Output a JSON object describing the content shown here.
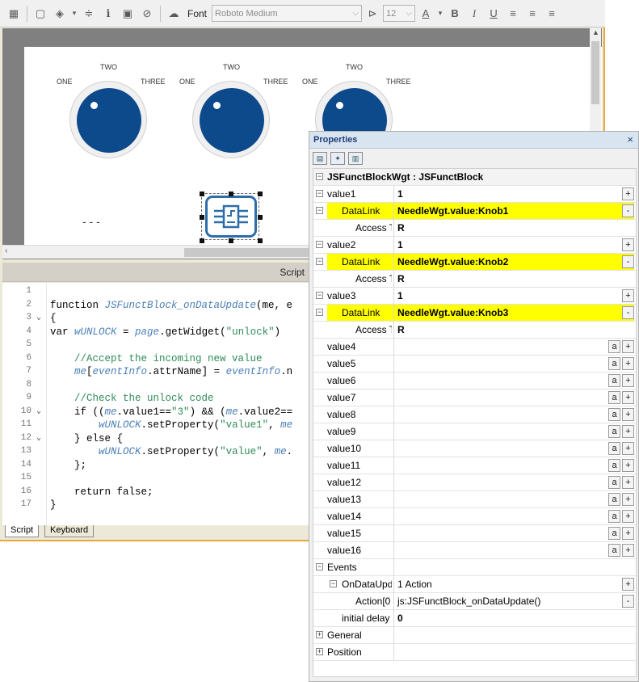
{
  "toolbar": {
    "font_label": "Font",
    "font_value": "Roboto Medium",
    "size_value": "12"
  },
  "knobs": [
    {
      "one": "ONE",
      "two": "TWO",
      "three": "THREE"
    },
    {
      "one": "ONE",
      "two": "TWO",
      "three": "THREE"
    },
    {
      "one": "ONE",
      "two": "TWO",
      "three": "THREE"
    }
  ],
  "canvas": {
    "dashes": "- - -"
  },
  "script": {
    "header": "Script",
    "lines": [
      {
        "n": "1",
        "fold": "",
        "html": ""
      },
      {
        "n": "2",
        "fold": "",
        "html": "function <span class='fn'>JSFunctBlock_onDataUpdate</span>(me, e"
      },
      {
        "n": "3",
        "fold": "⌄",
        "html": "{"
      },
      {
        "n": "4",
        "fold": "",
        "html": "var <span class='var'>wUNLOCK</span> = <span class='var'>page</span>.getWidget(<span class='str'>\"unlock\"</span>)"
      },
      {
        "n": "5",
        "fold": "",
        "html": ""
      },
      {
        "n": "6",
        "fold": "",
        "html": "    <span class='com'>//Accept the incoming new value</span>"
      },
      {
        "n": "7",
        "fold": "",
        "html": "    <span class='var'>me</span>[<span class='var'>eventInfo</span>.attrName] = <span class='var'>eventInfo</span>.n"
      },
      {
        "n": "8",
        "fold": "",
        "html": ""
      },
      {
        "n": "9",
        "fold": "",
        "html": "    <span class='com'>//Check the unlock code</span>"
      },
      {
        "n": "10",
        "fold": "⌄",
        "html": "    if ((<span class='var'>me</span>.value1==<span class='str'>\"3\"</span>) &amp;&amp; (<span class='var'>me</span>.value2=="
      },
      {
        "n": "11",
        "fold": "",
        "html": "        <span class='var'>wUNLOCK</span>.setProperty(<span class='str'>\"value1\"</span>, <span class='var'>me</span>"
      },
      {
        "n": "12",
        "fold": "⌄",
        "html": "    } else {"
      },
      {
        "n": "13",
        "fold": "",
        "html": "        <span class='var'>wUNLOCK</span>.setProperty(<span class='str'>\"value\"</span>, <span class='var'>me</span>."
      },
      {
        "n": "14",
        "fold": "",
        "html": "    };"
      },
      {
        "n": "15",
        "fold": "",
        "html": ""
      },
      {
        "n": "16",
        "fold": "",
        "html": "    return false;"
      },
      {
        "n": "17",
        "fold": "",
        "html": "}"
      }
    ]
  },
  "tabs": [
    "Script",
    "Keyboard"
  ],
  "properties": {
    "title": "Properties",
    "close": "×",
    "root": "JSFunctBlockWgt : JSFunctBlock",
    "rows": [
      {
        "type": "group",
        "label": "value1",
        "value": "1",
        "exp": "⊟",
        "plus": true
      },
      {
        "type": "link",
        "label": "DataLink",
        "value": "NeedleWgt.value:Knob1"
      },
      {
        "type": "access",
        "label": "Access T",
        "value": "R"
      },
      {
        "type": "group",
        "label": "value2",
        "value": "1",
        "exp": "⊟",
        "plus": true
      },
      {
        "type": "link",
        "label": "DataLink",
        "value": "NeedleWgt.value:Knob2"
      },
      {
        "type": "access",
        "label": "Access T",
        "value": "R"
      },
      {
        "type": "group",
        "label": "value3",
        "value": "1",
        "exp": "⊟",
        "plus": true
      },
      {
        "type": "link",
        "label": "DataLink",
        "value": "NeedleWgt.value:Knob3"
      },
      {
        "type": "access",
        "label": "Access T",
        "value": "R"
      },
      {
        "type": "plain",
        "label": "value4"
      },
      {
        "type": "plain",
        "label": "value5"
      },
      {
        "type": "plain",
        "label": "value6"
      },
      {
        "type": "plain",
        "label": "value7"
      },
      {
        "type": "plain",
        "label": "value8"
      },
      {
        "type": "plain",
        "label": "value9"
      },
      {
        "type": "plain",
        "label": "value10"
      },
      {
        "type": "plain",
        "label": "value11"
      },
      {
        "type": "plain",
        "label": "value12"
      },
      {
        "type": "plain",
        "label": "value13"
      },
      {
        "type": "plain",
        "label": "value14"
      },
      {
        "type": "plain",
        "label": "value15"
      },
      {
        "type": "plain",
        "label": "value16"
      },
      {
        "type": "section",
        "label": "Events"
      },
      {
        "type": "event",
        "label": "OnDataUpd",
        "value": "1 Action"
      },
      {
        "type": "action",
        "label": "Action[0",
        "value": "js:JSFunctBlock_onDataUpdate()"
      },
      {
        "type": "delay",
        "label": "initial delay",
        "value": "0"
      },
      {
        "type": "collapsed",
        "label": "General"
      },
      {
        "type": "collapsed",
        "label": "Position"
      }
    ],
    "btn_a": "a",
    "btn_plus": "+",
    "btn_minus": "-"
  }
}
